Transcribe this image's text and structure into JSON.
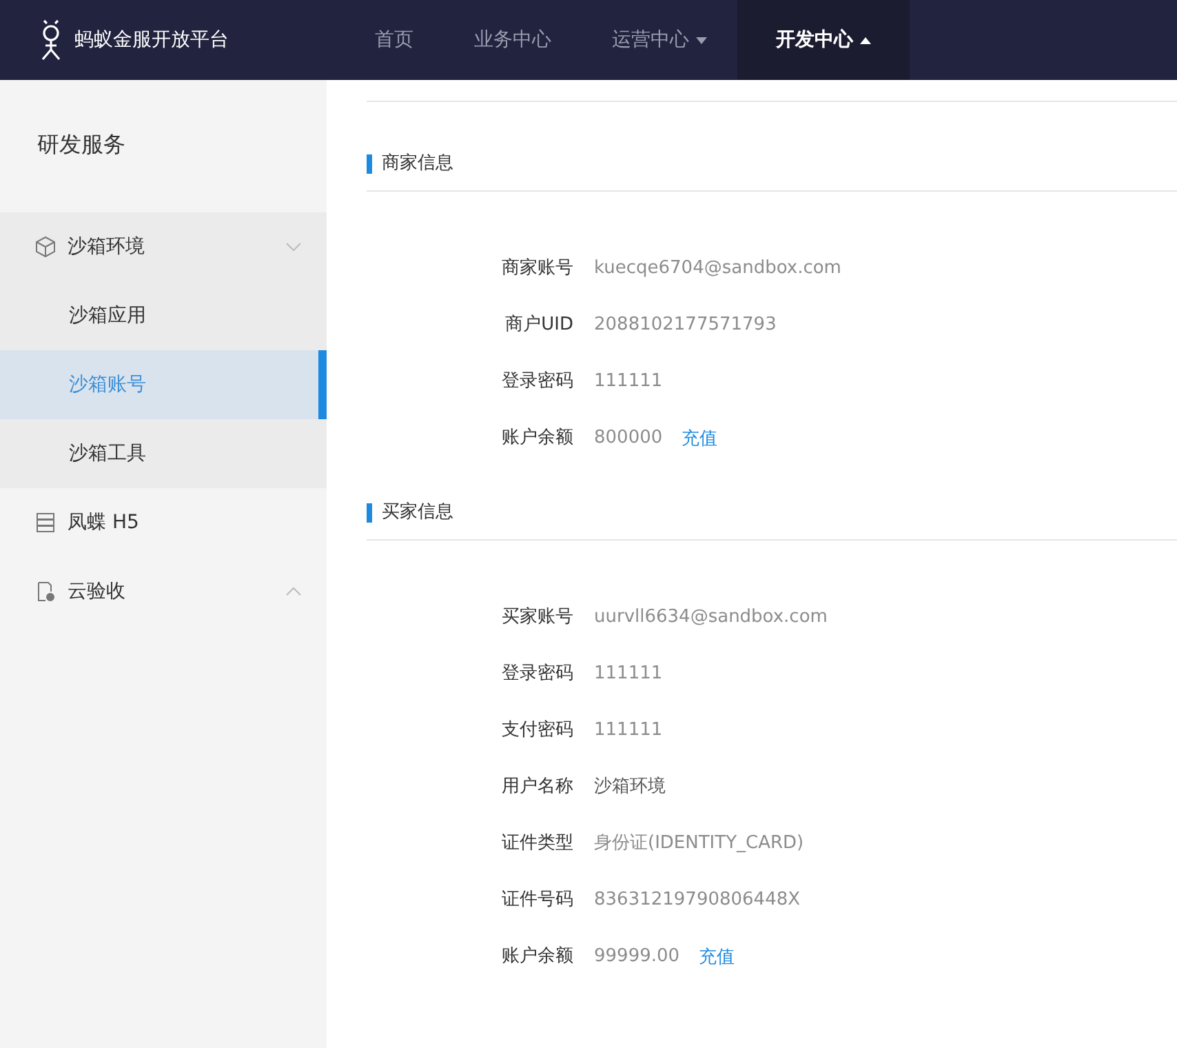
{
  "header": {
    "brand": "蚂蚁金服开放平台",
    "nav": [
      {
        "label": "首页",
        "selected": false,
        "kind": "link"
      },
      {
        "label": "业务中心",
        "selected": false,
        "kind": "link"
      },
      {
        "label": "运营中心",
        "selected": false,
        "kind": "dropdown",
        "expanded": false
      },
      {
        "label": "开发中心",
        "selected": true,
        "kind": "dropdown",
        "expanded": true
      }
    ]
  },
  "sidebar": {
    "title": "研发服务",
    "items": [
      {
        "label": "沙箱环境",
        "kind": "group",
        "expanded": true,
        "children": [
          {
            "label": "沙箱应用",
            "selected": false
          },
          {
            "label": "沙箱账号",
            "selected": true
          },
          {
            "label": "沙箱工具",
            "selected": false
          }
        ]
      },
      {
        "label": "凤蝶 H5",
        "kind": "link"
      },
      {
        "label": "云验收",
        "kind": "group",
        "expanded": false
      }
    ]
  },
  "sections": [
    {
      "title": "商家信息",
      "fields": [
        {
          "label": "商家账号",
          "value": "kuecqe6704@sandbox.com"
        },
        {
          "label": "商户UID",
          "value": "2088102177571793"
        },
        {
          "label": "登录密码",
          "value": "111111"
        },
        {
          "label": "账户余额",
          "value": "800000",
          "action": "充值"
        }
      ]
    },
    {
      "title": "买家信息",
      "fields": [
        {
          "label": "买家账号",
          "value": "uurvll6634@sandbox.com"
        },
        {
          "label": "登录密码",
          "value": "111111"
        },
        {
          "label": "支付密码",
          "value": "111111"
        },
        {
          "label": "用户名称",
          "value": "沙箱环境",
          "emphasis": true
        },
        {
          "label": "证件类型",
          "value": "身份证(IDENTITY_CARD)"
        },
        {
          "label": "证件号码",
          "value": "83631219790806448X"
        },
        {
          "label": "账户余额",
          "value": "99999.00",
          "action": "充值"
        }
      ]
    }
  ]
}
